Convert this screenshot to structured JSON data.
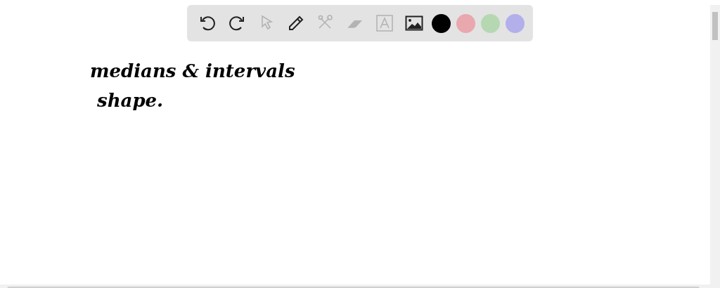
{
  "toolbar": {
    "tools": [
      {
        "kind": "undo",
        "disabled": false
      },
      {
        "kind": "redo",
        "disabled": false
      },
      {
        "kind": "pointer",
        "disabled": true
      },
      {
        "kind": "pen",
        "disabled": false
      },
      {
        "kind": "shapes",
        "disabled": true
      },
      {
        "kind": "eraser",
        "disabled": true
      },
      {
        "kind": "text",
        "disabled": true
      },
      {
        "kind": "image",
        "disabled": false
      }
    ],
    "colors": [
      {
        "color": "#000000"
      },
      {
        "color": "#e9a7ae"
      },
      {
        "color": "#b5d8b3"
      },
      {
        "color": "#b3afeb"
      }
    ]
  },
  "notes": [
    "medians & intervals",
    "shape."
  ]
}
